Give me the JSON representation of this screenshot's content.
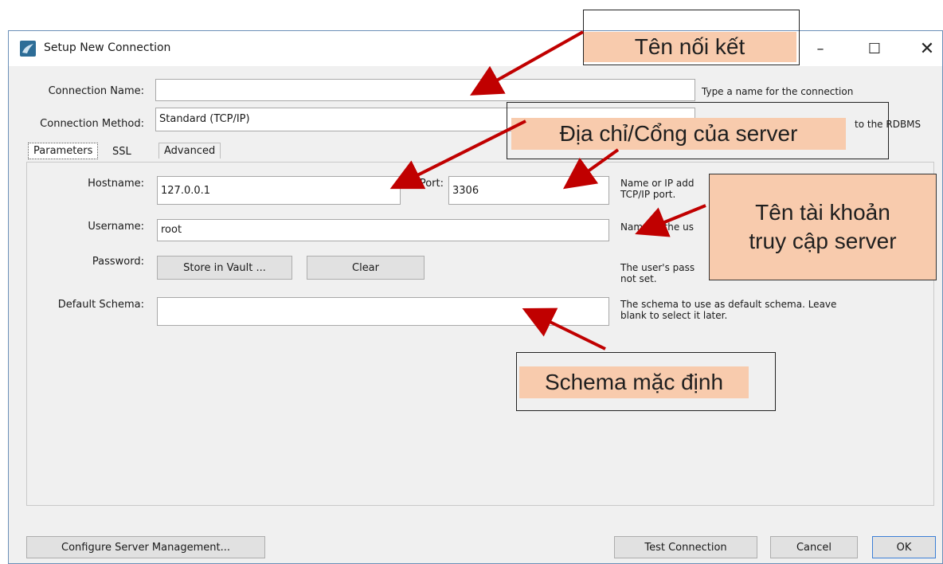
{
  "window": {
    "title": "Setup New Connection",
    "controls": {
      "minimize": "–",
      "maximize": "☐",
      "close": "✕"
    }
  },
  "form": {
    "connection_name": {
      "label": "Connection Name:",
      "value": "",
      "help": "Type a name for the connection"
    },
    "connection_method": {
      "label": "Connection Method:",
      "value": "Standard (TCP/IP)",
      "help_visible": "to the RDBMS"
    },
    "tabs": [
      {
        "label": "Parameters",
        "active": true
      },
      {
        "label": "SSL",
        "active": false
      },
      {
        "label": "Advanced",
        "active": false
      }
    ],
    "hostname": {
      "label": "Hostname:",
      "value": "127.0.0.1",
      "help_line1": "Name or IP add",
      "help_line2": "TCP/IP port."
    },
    "port": {
      "label": "Port:",
      "value": "3306"
    },
    "username": {
      "label": "Username:",
      "value": "root",
      "help": "Name of the us"
    },
    "password": {
      "label": "Password:",
      "store_button": "Store in Vault ...",
      "clear_button": "Clear",
      "help_line1": "The user's pass",
      "help_line2": "not set."
    },
    "default_schema": {
      "label": "Default Schema:",
      "value": "",
      "help_line1": "The schema to use as default schema. Leave",
      "help_line2": "blank to select it later."
    }
  },
  "footer": {
    "configure_button": "Configure Server Management...",
    "test_button": "Test Connection",
    "cancel_button": "Cancel",
    "ok_button": "OK"
  },
  "annotations": {
    "connection_name_callout": "Tên nối kết",
    "server_address_callout": "Địa chỉ/Cổng của server",
    "account_callout_line1": "Tên tài khoản",
    "account_callout_line2": "truy cập server",
    "schema_callout": "Schema mặc định",
    "arrow_color": "#c00000",
    "callout_color": "#f8cbad"
  }
}
